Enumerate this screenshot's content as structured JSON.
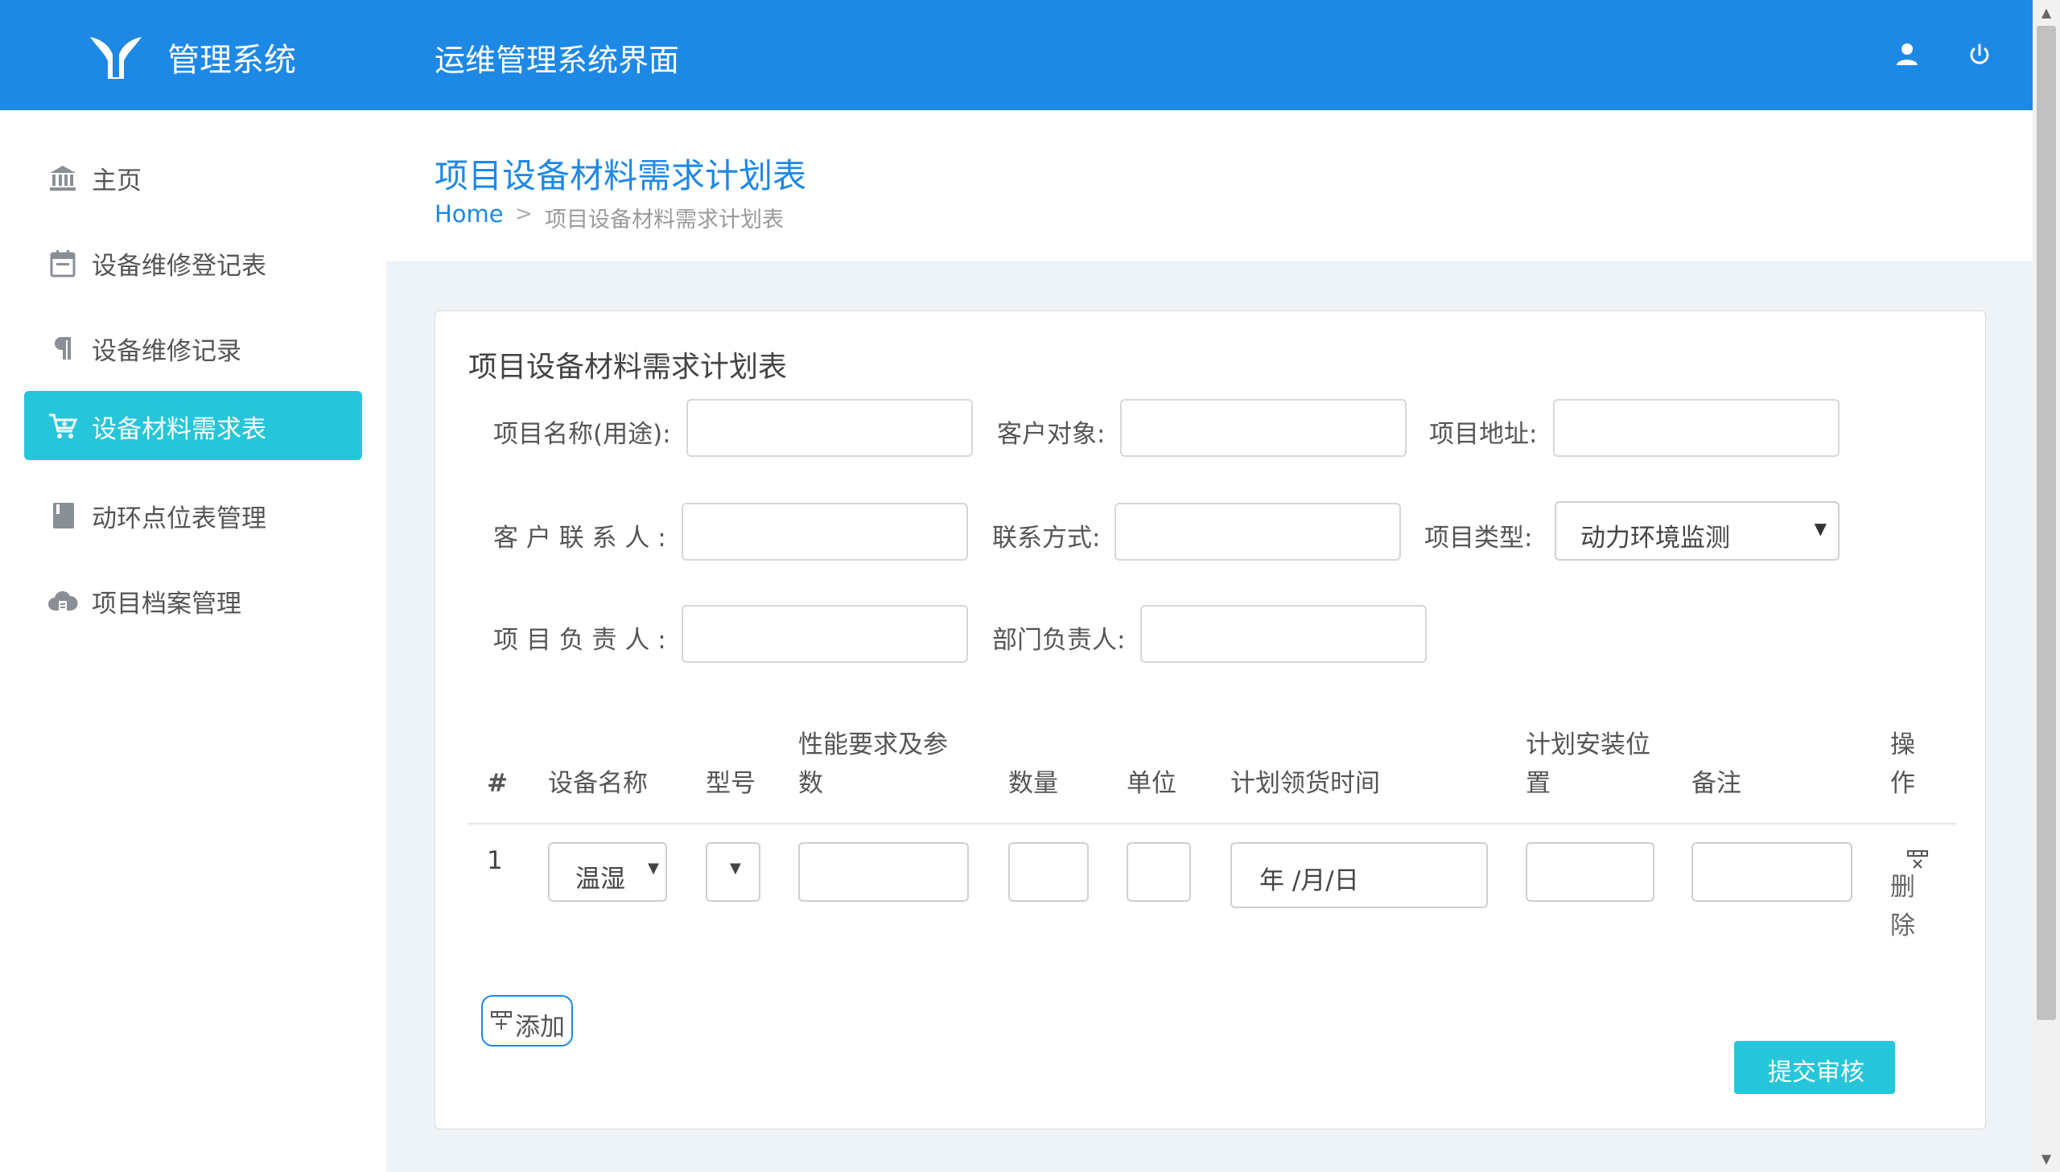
{
  "header": {
    "brand": "管理系统",
    "app_title": "运维管理系统界面",
    "user_icon": "user-icon",
    "power_icon": "power-icon",
    "color": "#1e88e5"
  },
  "sidebar": {
    "items": [
      {
        "label": "主页",
        "icon": "bank-icon"
      },
      {
        "label": "设备维修登记表",
        "icon": "calendar-icon"
      },
      {
        "label": "设备维修记录",
        "icon": "paragraph-icon"
      },
      {
        "label": "设备材料需求表",
        "icon": "cart-icon",
        "active": true
      },
      {
        "label": "动环点位表管理",
        "icon": "book-icon"
      },
      {
        "label": "项目档案管理",
        "icon": "cloud-icon"
      }
    ],
    "active_color": "#26c6da"
  },
  "page": {
    "title": "项目设备材料需求计划表",
    "breadcrumb_home": "Home",
    "breadcrumb_sep": ">",
    "breadcrumb_current": "项目设备材料需求计划表"
  },
  "form": {
    "title": "项目设备材料需求计划表",
    "project_name_label": "项目名称(用途):",
    "project_name_value": "",
    "customer_label": "客户对象:",
    "customer_value": "",
    "address_label": "项目地址:",
    "address_value": "",
    "contact_person_label": "客 户 联 系 人 :",
    "contact_person_value": "",
    "contact_method_label": "联系方式:",
    "contact_method_value": "",
    "project_type_label": "项目类型:",
    "project_type_value": "动力环境监测",
    "project_manager_label": "项 目 负 责 人 :",
    "project_manager_value": "",
    "dept_manager_label": "部门负责人:",
    "dept_manager_value": ""
  },
  "table": {
    "headers": {
      "index": "#",
      "name": "设备名称",
      "model": "型号",
      "spec_line1": "性能要求及参",
      "spec_line2": "数",
      "qty": "数量",
      "unit": "单位",
      "date": "计划领货时间",
      "loc_line1": "计划安装位",
      "loc_line2": "置",
      "remark": "备注",
      "op_line1": "操",
      "op_line2": "作"
    },
    "rows": [
      {
        "index": "1",
        "name": "温湿",
        "model": "",
        "spec": "",
        "qty": "",
        "unit": "",
        "date_placeholder": "年 /月/日",
        "location": "",
        "remark": "",
        "delete_line1": "删",
        "delete_line2": "除"
      }
    ]
  },
  "actions": {
    "add_label": "添加",
    "submit_label": "提交审核"
  }
}
